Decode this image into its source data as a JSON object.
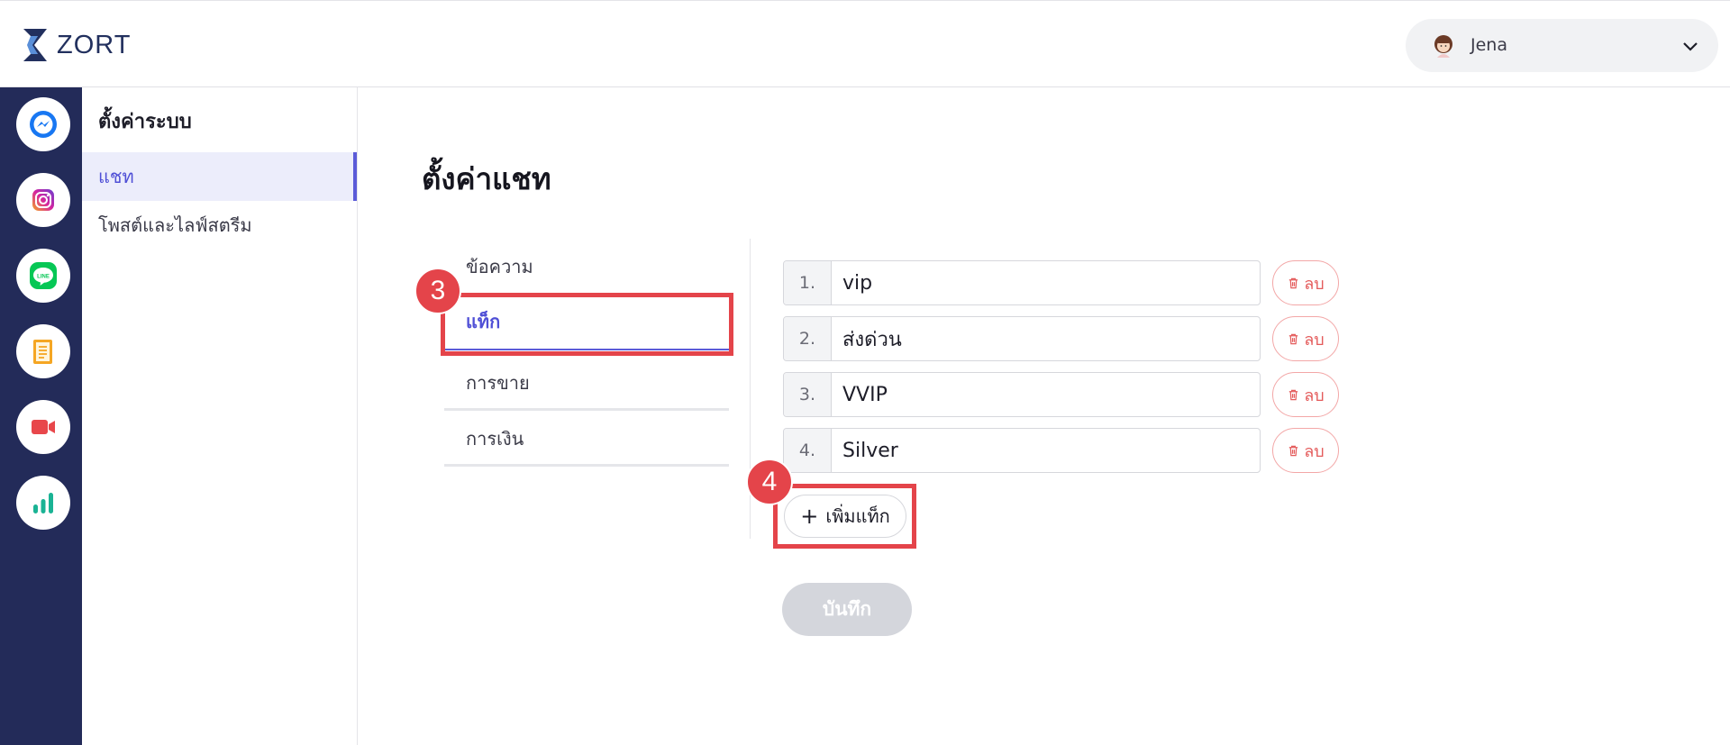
{
  "header": {
    "logo_text": "ZORT",
    "user": {
      "name": "Jena"
    }
  },
  "rail": {
    "items": [
      {
        "icon": "messenger-icon",
        "color": "#1877f2"
      },
      {
        "icon": "instagram-icon",
        "color": "#c13584"
      },
      {
        "icon": "line-icon",
        "color": "#06c755"
      },
      {
        "icon": "notes-icon",
        "color": "#f5a623"
      },
      {
        "icon": "live-video-icon",
        "color": "#e8474b"
      },
      {
        "icon": "analytics-icon",
        "color": "#1ab394"
      }
    ]
  },
  "settings_nav": {
    "title": "ตั้งค่าระบบ",
    "items": [
      {
        "label": "แชท",
        "active": true
      },
      {
        "label": "โพสต์และไลฟ์สตรีม",
        "active": false
      }
    ]
  },
  "main": {
    "title": "ตั้งค่าแชท",
    "tabs": [
      {
        "label": "ข้อความ",
        "active": false
      },
      {
        "label": "แท็ก",
        "active": true
      },
      {
        "label": "การขาย",
        "active": false
      },
      {
        "label": "การเงิน",
        "active": false
      }
    ],
    "tags": [
      {
        "num": "1.",
        "value": "vip",
        "delete_label": "ลบ"
      },
      {
        "num": "2.",
        "value": "ส่งด่วน",
        "delete_label": "ลบ"
      },
      {
        "num": "3.",
        "value": "VVIP",
        "delete_label": "ลบ"
      },
      {
        "num": "4.",
        "value": "Silver",
        "delete_label": "ลบ"
      }
    ],
    "add_tag_label": "เพิ่มแท็ก",
    "save_label": "บันทึก"
  },
  "annotations": [
    {
      "number": "3"
    },
    {
      "number": "4"
    }
  ],
  "colors": {
    "rail_bg": "#232b59",
    "accent": "#5b5bd8",
    "danger": "#e45b5b",
    "callout": "#e4444a"
  }
}
